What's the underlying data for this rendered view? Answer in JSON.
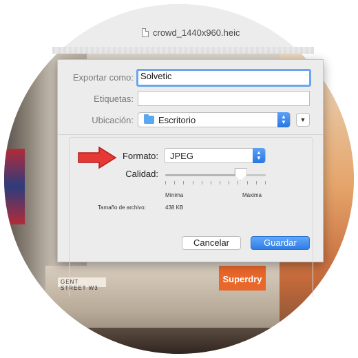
{
  "window": {
    "title": "crowd_1440x960.heic"
  },
  "background": {
    "street_sign": "GENT STREET W3",
    "shop_sign": "Superdry"
  },
  "dialog": {
    "export_as": {
      "label": "Exportar como:",
      "value": "Solvetic"
    },
    "tags": {
      "label": "Etiquetas:",
      "value": ""
    },
    "location": {
      "label": "Ubicación:",
      "value": "Escritorio",
      "icon": "folder-icon"
    },
    "expand_icon": "chevron-down-icon",
    "format": {
      "label": "Formato:",
      "value": "JPEG"
    },
    "quality": {
      "label": "Calidad:",
      "min_label": "Mínima",
      "max_label": "Máxima",
      "level": 0.75
    },
    "file_size": {
      "label": "Tamaño de archivo:",
      "value": "438 KB"
    },
    "cancel_label": "Cancelar",
    "save_label": "Guardar",
    "accent_color": "#2f7de6",
    "annotation_arrow_color": "#e53935"
  }
}
